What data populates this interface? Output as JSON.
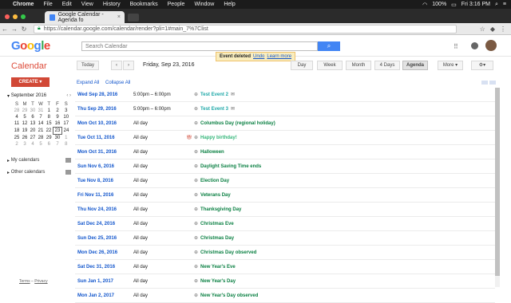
{
  "menubar": {
    "app": "Chrome",
    "items": [
      "File",
      "Edit",
      "View",
      "History",
      "Bookmarks",
      "People",
      "Window",
      "Help"
    ],
    "battery": "100%",
    "clock": "Fri 3:16 PM"
  },
  "tab": {
    "title": "Google Calendar - Agenda fo"
  },
  "omnibox": {
    "url": "https://calendar.google.com/calendar/render?pli=1#main_7%7Clist"
  },
  "header": {
    "logo": "Google",
    "search_placeholder": "Search Calendar"
  },
  "toast": {
    "text": "Event deleted",
    "undo": "Undo",
    "learn_more": "Learn more"
  },
  "calendar": {
    "title": "Calendar",
    "today": "Today",
    "prev": "‹",
    "next": "›",
    "date_range": "Friday, Sep 23, 2016",
    "views": [
      "Day",
      "Week",
      "Month",
      "4 Days",
      "Agenda"
    ],
    "active_view": "Agenda",
    "more": "More ▾",
    "settings_icon": "gear-icon"
  },
  "sidebar": {
    "create": "CREATE",
    "mini_month": "September 2016",
    "weekday_headers": [
      "S",
      "M",
      "T",
      "W",
      "T",
      "F",
      "S"
    ],
    "weeks": [
      [
        "28",
        "29",
        "30",
        "31",
        "1",
        "2",
        "3"
      ],
      [
        "4",
        "5",
        "6",
        "7",
        "8",
        "9",
        "10"
      ],
      [
        "11",
        "12",
        "13",
        "14",
        "15",
        "16",
        "17"
      ],
      [
        "18",
        "19",
        "20",
        "21",
        "22",
        "23",
        "24"
      ],
      [
        "25",
        "26",
        "27",
        "28",
        "29",
        "30",
        "1"
      ],
      [
        "2",
        "3",
        "4",
        "5",
        "6",
        "7",
        "8"
      ]
    ],
    "my_calendars": "My calendars",
    "other_calendars": "Other calendars",
    "terms": "Terms",
    "privacy": "Privacy"
  },
  "agenda": {
    "expand_all": "Expand All",
    "collapse_all": "Collapse All",
    "events": [
      {
        "date": "Wed Sep 28, 2016",
        "time": "5:00pm – 6:00pm",
        "title": "Test Event 2",
        "color": "#1fa8a8",
        "mail": true,
        "gift": false
      },
      {
        "date": "Thu Sep 29, 2016",
        "time": "5:00pm – 6:00pm",
        "title": "Test Event 3",
        "color": "#1fa8a8",
        "mail": true,
        "gift": false
      },
      {
        "date": "Mon Oct 10, 2016",
        "time": "All day",
        "title": "Columbus Day (regional holiday)",
        "color": "#0b8043",
        "mail": false,
        "gift": false
      },
      {
        "date": "Tue Oct 11, 2016",
        "time": "All day",
        "title": "Happy birthday!",
        "color": "#33b679",
        "mail": false,
        "gift": true
      },
      {
        "date": "Mon Oct 31, 2016",
        "time": "All day",
        "title": "Halloween",
        "color": "#0b8043",
        "mail": false,
        "gift": false
      },
      {
        "date": "Sun Nov 6, 2016",
        "time": "All day",
        "title": "Daylight Saving Time ends",
        "color": "#0b8043",
        "mail": false,
        "gift": false
      },
      {
        "date": "Tue Nov 8, 2016",
        "time": "All day",
        "title": "Election Day",
        "color": "#0b8043",
        "mail": false,
        "gift": false
      },
      {
        "date": "Fri Nov 11, 2016",
        "time": "All day",
        "title": "Veterans Day",
        "color": "#0b8043",
        "mail": false,
        "gift": false
      },
      {
        "date": "Thu Nov 24, 2016",
        "time": "All day",
        "title": "Thanksgiving Day",
        "color": "#0b8043",
        "mail": false,
        "gift": false
      },
      {
        "date": "Sat Dec 24, 2016",
        "time": "All day",
        "title": "Christmas Eve",
        "color": "#0b8043",
        "mail": false,
        "gift": false
      },
      {
        "date": "Sun Dec 25, 2016",
        "time": "All day",
        "title": "Christmas Day",
        "color": "#0b8043",
        "mail": false,
        "gift": false
      },
      {
        "date": "Mon Dec 26, 2016",
        "time": "All day",
        "title": "Christmas Day observed",
        "color": "#0b8043",
        "mail": false,
        "gift": false
      },
      {
        "date": "Sat Dec 31, 2016",
        "time": "All day",
        "title": "New Year's Eve",
        "color": "#0b8043",
        "mail": false,
        "gift": false
      },
      {
        "date": "Sun Jan 1, 2017",
        "time": "All day",
        "title": "New Year's Day",
        "color": "#0b8043",
        "mail": false,
        "gift": false
      },
      {
        "date": "Mon Jan 2, 2017",
        "time": "All day",
        "title": "New Year's Day observed",
        "color": "#0b8043",
        "mail": false,
        "gift": false
      }
    ]
  }
}
